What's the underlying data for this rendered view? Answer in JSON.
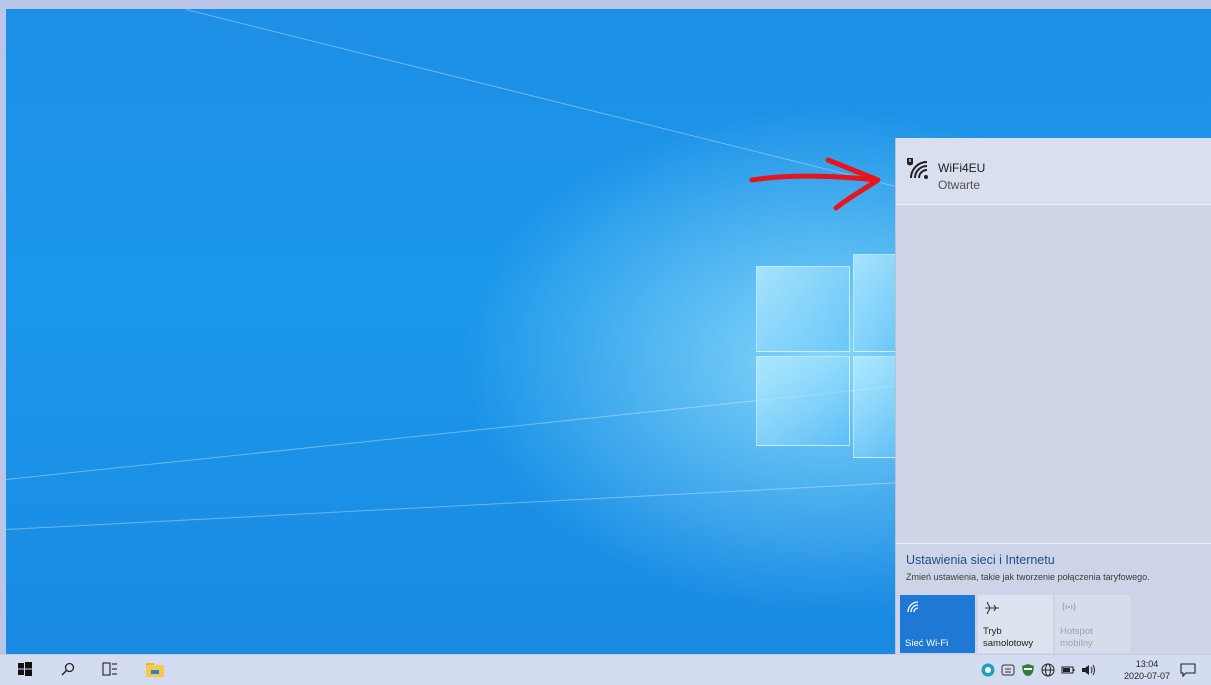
{
  "network_flyout": {
    "network": {
      "name": "WiFi4EU",
      "status": "Otwarte"
    },
    "settings_link": "Ustawienia sieci i Internetu",
    "settings_desc": "Zmień ustawienia, takie jak tworzenie połączenia taryfowego.",
    "tiles": {
      "wifi": {
        "label": "Sieć Wi-Fi",
        "icon": "wifi-icon"
      },
      "airplane": {
        "label_line1": "Tryb",
        "label_line2": "samolotowy",
        "icon": "airplane-icon"
      },
      "hotspot": {
        "label_line1": "Hotspot",
        "label_line2": "mobilny",
        "icon": "hotspot-icon"
      }
    }
  },
  "taskbar": {
    "time": "13:04",
    "date": "2020-07-07"
  },
  "colors": {
    "accent": "#1e78d4",
    "annotation_arrow": "#e8141b",
    "flyout_bg": "#cfd6e8",
    "taskbar_bg": "#d3dcf0"
  }
}
